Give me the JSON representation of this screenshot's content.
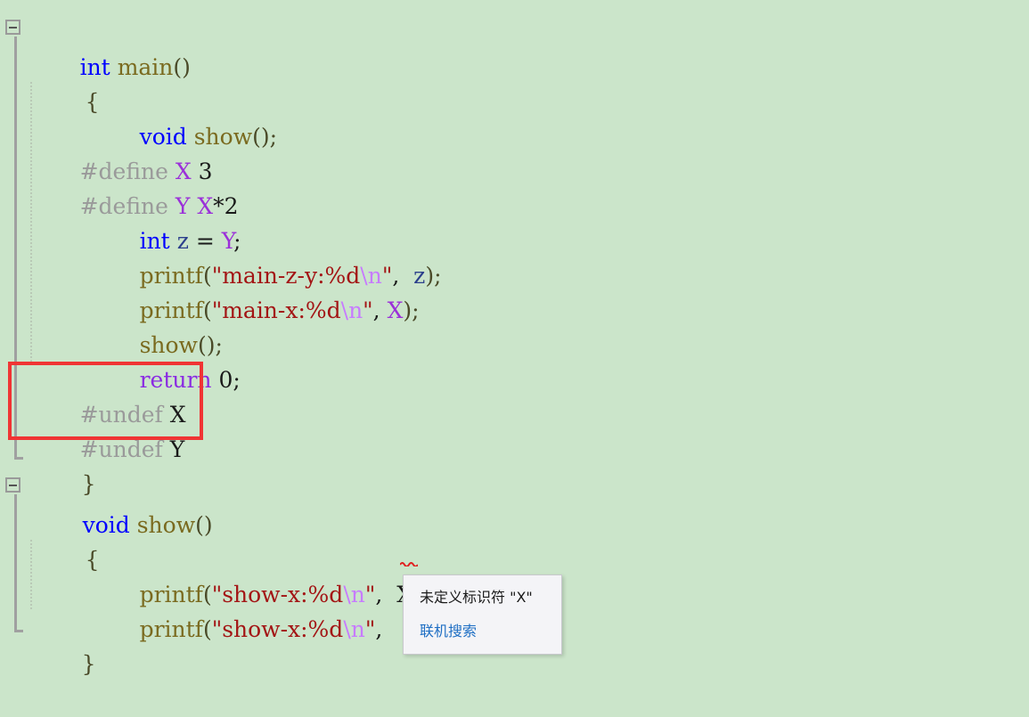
{
  "editor": {
    "background_color": "#cbe5ca",
    "font_size_px": 25,
    "lines": [
      {
        "indent": 0,
        "text": "int main()"
      },
      {
        "indent": 0,
        "text": "{"
      },
      {
        "indent": 0,
        "text": "void show();"
      },
      {
        "indent": 0,
        "text": "#define X 3"
      },
      {
        "indent": 0,
        "text": "#define Y X*2"
      },
      {
        "indent": 0,
        "text": "int z = Y;"
      },
      {
        "indent": 0,
        "text": "printf(\"main-z-y:%d\\n\", z);"
      },
      {
        "indent": 0,
        "text": "printf(\"main-x:%d\\n\", X);"
      },
      {
        "indent": 0,
        "text": "show();"
      },
      {
        "indent": 0,
        "text": "return 0;"
      },
      {
        "indent": 0,
        "text": "#undef X"
      },
      {
        "indent": 0,
        "text": "#undef Y"
      },
      {
        "indent": 0,
        "text": "}"
      },
      {
        "indent": 0,
        "text": "void show()"
      },
      {
        "indent": 0,
        "text": "{"
      },
      {
        "indent": 0,
        "text": "printf(\"show-x:%d\\n\", X);"
      },
      {
        "indent": 0,
        "text": "printf(\"show-x:%d\\n\", "
      },
      {
        "indent": 0,
        "text": "}"
      }
    ]
  },
  "tokens": {
    "l1_int": "int",
    "l1_main": "main",
    "l1_parens": "()",
    "l2_brace": "{",
    "l3_void": "void",
    "l3_show": "show",
    "l3_tail": "();",
    "l4_define": "#define",
    "l4_name": "X",
    "l4_value": "3",
    "l5_define": "#define",
    "l5_name": "Y",
    "l5_body_x": "X",
    "l5_body_rest": "*2",
    "l6_int": "int",
    "l6_var": "z",
    "l6_eq": "=",
    "l6_macro": "Y",
    "l6_semi": ";",
    "l7_printf": "printf",
    "l7_open": "(",
    "l7_str": "\"main-z-y:%d",
    "l7_esc": "\\n",
    "l7_strend": "\"",
    "l7_comma": ",",
    "l7_arg": "z",
    "l7_close": ");",
    "l8_printf": "printf",
    "l8_open": "(",
    "l8_str": "\"main-x:%d",
    "l8_esc": "\\n",
    "l8_strend": "\"",
    "l8_comma": ",",
    "l8_arg": "X",
    "l8_close": ");",
    "l9_show": "show",
    "l9_tail": "();",
    "l10_return": "return",
    "l10_zero": "0",
    "l10_semi": ";",
    "l11_undef": "#undef",
    "l11_name": "X",
    "l12_undef": "#undef",
    "l12_name": "Y",
    "l13_brace": "}",
    "l14_void": "void",
    "l14_show": "show",
    "l14_parens": "()",
    "l15_brace": "{",
    "l16_printf": "printf",
    "l16_open": "(",
    "l16_str": "\"show-x:%d",
    "l16_esc": "\\n",
    "l16_strend": "\"",
    "l16_comma": ",",
    "l16_arg": "X",
    "l16_close": ");",
    "l17_printf": "printf",
    "l17_open": "(",
    "l17_str": "\"show-x:%d",
    "l17_esc": "\\n",
    "l17_strend": "\"",
    "l17_comma": ",",
    "l18_brace": "}"
  },
  "annotation": {
    "color": "#f03434",
    "label": "undef-highlight-box"
  },
  "tooltip": {
    "message": "未定义标识符 \"X\"",
    "link": "联机搜索"
  },
  "colors": {
    "keyword": "#0000ff",
    "control_keyword": "#8a2be2",
    "function": "#7a6a1f",
    "string": "#a31515",
    "escape": "#c77bff",
    "macro_directive": "#9a9a9a",
    "macro_name": "#9b30d9",
    "variable": "#2b3f8c",
    "error_underline": "#e02020",
    "tooltip_link": "#1f6fc4"
  }
}
